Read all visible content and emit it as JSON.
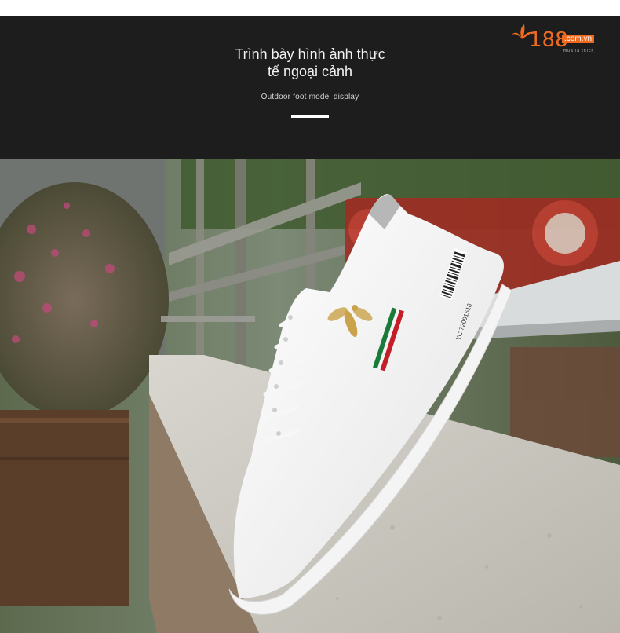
{
  "banner": {
    "headline_line1": "Trình bày hình ảnh thực",
    "headline_line2": "tế ngoại cảnh",
    "subtitle": "Outdoor foot model display"
  },
  "logo": {
    "number": "188",
    "domain": ".com.vn",
    "tagline": "mua là thích"
  },
  "product": {
    "tag_code": "YC 72091518"
  },
  "colors": {
    "banner_bg": "#1d1d1d",
    "logo_orange": "#f06b22",
    "stripe_green": "#1a7a3a",
    "stripe_red": "#c41e28",
    "embroidery_gold": "#c9a24a"
  }
}
